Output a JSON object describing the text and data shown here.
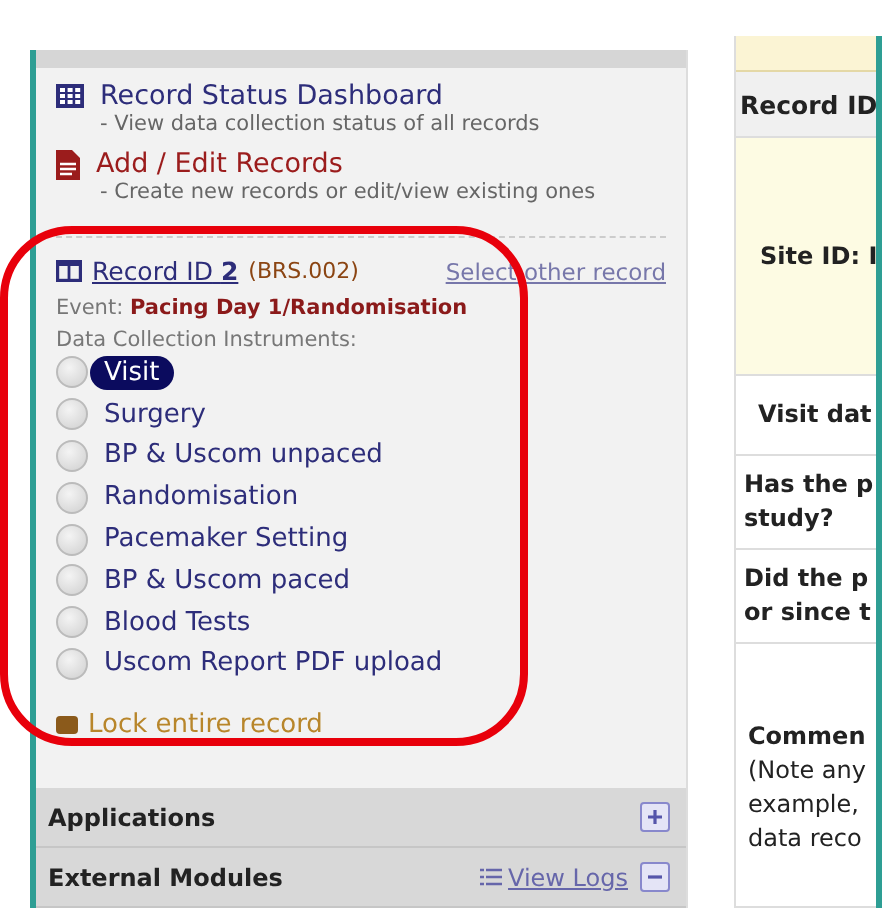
{
  "menu": [
    {
      "kind": "grid",
      "title": "Record Status Dashboard",
      "desc": "- View data collection status of all records"
    },
    {
      "kind": "file",
      "title": "Add / Edit Records",
      "desc": "- Create new records or edit/view existing ones"
    }
  ],
  "record": {
    "label": "Record ID",
    "id": "2",
    "secondary": "(BRS.002)",
    "select_link": "Select other record",
    "event_label": "Event:",
    "event": "Pacing Day 1/Randomisation",
    "instruments_label": "Data Collection Instruments:",
    "instruments": [
      {
        "name": "Visit",
        "selected": true
      },
      {
        "name": "Surgery",
        "selected": false
      },
      {
        "name": "BP & Uscom unpaced",
        "selected": false
      },
      {
        "name": "Randomisation",
        "selected": false
      },
      {
        "name": "Pacemaker Setting",
        "selected": false
      },
      {
        "name": "BP & Uscom paced",
        "selected": false
      },
      {
        "name": "Blood Tests",
        "selected": false
      },
      {
        "name": "Uscom Report PDF upload",
        "selected": false
      }
    ],
    "lock": "Lock entire record"
  },
  "sections": [
    {
      "title": "Applications",
      "expanded": false
    },
    {
      "title": "External Modules",
      "link": "View Logs",
      "expanded": true
    }
  ],
  "form_rows": [
    {
      "kind": "header",
      "lines": [
        "Record ID"
      ]
    },
    {
      "kind": "highlight",
      "lines": [
        "Site ID: I"
      ]
    },
    {
      "kind": "plain",
      "lines": [
        "Visit dat"
      ]
    },
    {
      "kind": "plain",
      "lines": [
        "Has the p",
        "study?"
      ]
    },
    {
      "kind": "plain",
      "lines": [
        "Did the p",
        "or since t"
      ]
    },
    {
      "kind": "note",
      "lines": [
        "Commen",
        "(Note any",
        "example,",
        "data reco"
      ]
    }
  ]
}
